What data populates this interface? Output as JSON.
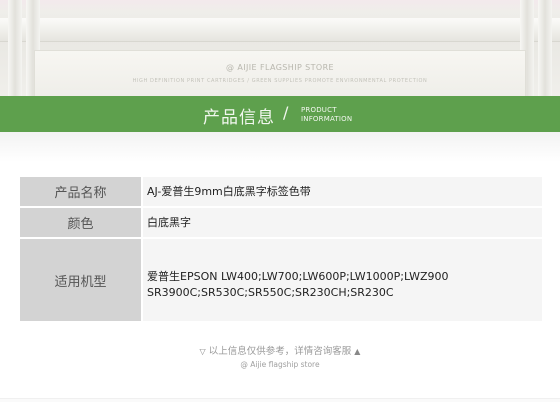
{
  "banner": {
    "brand_mark": "@",
    "brand_name": "AIJIE FLAGSHIP STORE",
    "tagline": "HIGH DEFINITION PRINT CARTRIDGES / GREEN SUPPLIES PROMOTE ENVIRONMENTAL PROTECTION"
  },
  "section": {
    "title_cn": "产品信息",
    "slash": "/",
    "title_en_line1": "PRODUCT",
    "title_en_line2": "INFORMATION",
    "color": "#5ea04d"
  },
  "product_info": {
    "rows": [
      {
        "label": "产品名称",
        "value": "AJ-爱普生9mm白底黑字标签色带"
      },
      {
        "label": "颜色",
        "value": "白底黑字"
      },
      {
        "label": "适用机型",
        "value": "爱普生EPSON LW400;LW700;LW600P;LW1000P;LWZ900 SR3900C;SR530C;SR550C;SR230CH;SR230C"
      }
    ]
  },
  "footer": {
    "arrow_down": "▽",
    "note": "以上信息仅供参考，详情咨询客服",
    "arrow_up": "▲",
    "brand": "@ Aijie flagship store"
  }
}
